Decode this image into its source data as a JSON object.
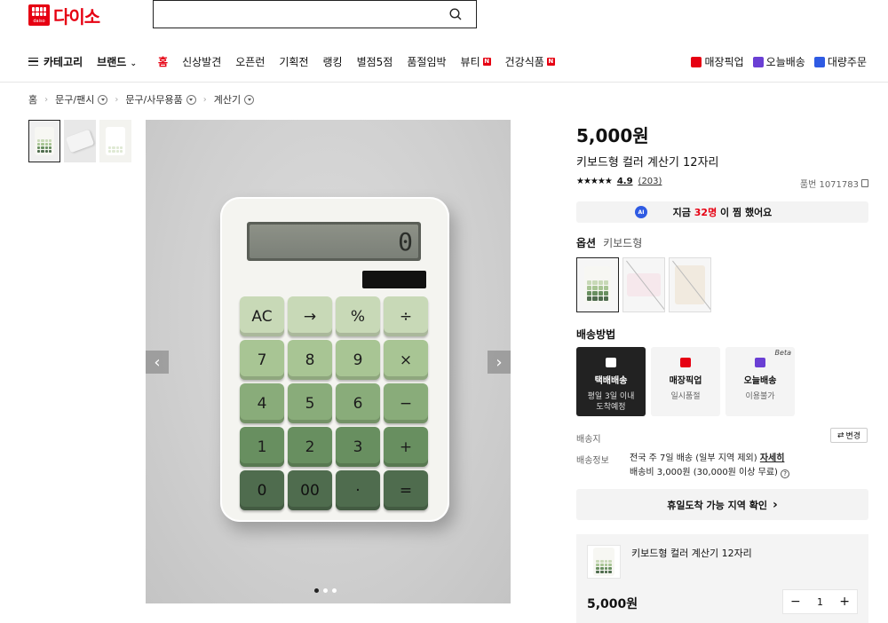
{
  "header": {
    "logo_text": "다이소",
    "logo_small": "daiso",
    "search_placeholder": ""
  },
  "nav": {
    "category": "카테고리",
    "brand": "브랜드",
    "items": [
      {
        "label": "홈",
        "badge": ""
      },
      {
        "label": "신상발견",
        "badge": ""
      },
      {
        "label": "오픈런",
        "badge": ""
      },
      {
        "label": "기획전",
        "badge": ""
      },
      {
        "label": "랭킹",
        "badge": ""
      },
      {
        "label": "별점5점",
        "badge": ""
      },
      {
        "label": "품절임박",
        "badge": ""
      },
      {
        "label": "뷰티",
        "badge": "N"
      },
      {
        "label": "건강식품",
        "badge": "N"
      }
    ],
    "right": [
      {
        "label": "매장픽업",
        "color": "#e60012"
      },
      {
        "label": "오늘배송",
        "color": "#6a3fd4"
      },
      {
        "label": "대량주문",
        "color": "#2f5be3"
      }
    ]
  },
  "breadcrumb": {
    "home": "홈",
    "items": [
      "문구/팬시",
      "문구/사무용품",
      "계산기"
    ]
  },
  "calculator": {
    "display": "0",
    "keys": [
      [
        "AC",
        "→",
        "%",
        "÷"
      ],
      [
        "7",
        "8",
        "9",
        "×"
      ],
      [
        "4",
        "5",
        "6",
        "−"
      ],
      [
        "1",
        "2",
        "3",
        "+"
      ],
      [
        "0",
        "00",
        "·",
        "="
      ]
    ]
  },
  "gallery": {
    "arrow_left": "‹",
    "arrow_right": "›",
    "slide_count": 3,
    "active_slide": 1
  },
  "product": {
    "price": "5,000원",
    "name": "키보드형 컬러 계산기 12자리",
    "stars": "★★★★★",
    "rating": "4.9",
    "review_count": "(203)",
    "product_no": "품번 1071783",
    "ai_badge": "AI",
    "wish_text_prefix": "지금",
    "wish_count": "32명",
    "wish_text_suffix": "이 찜 했어요"
  },
  "options": {
    "label": "옵션",
    "selected": "키보드형"
  },
  "shipping": {
    "title": "배송방법",
    "methods": [
      {
        "name": "택배배송",
        "desc1": "평일 3일 이내",
        "desc2": "도착예정",
        "icon_color": "#ffffff"
      },
      {
        "name": "매장픽업",
        "desc1": "일시품절",
        "desc2": "",
        "icon_color": "#e60012"
      },
      {
        "name": "오늘배송",
        "desc1": "이용불가",
        "desc2": "",
        "icon_color": "#6a3fd4",
        "beta": "Beta"
      }
    ],
    "address_label": "배송지",
    "change_btn": "변경",
    "change_icon": "⇄",
    "info_label": "배송정보",
    "info_line1": "전국 주 7일 배송 (일부 지역 제외)",
    "info_link": "자세히",
    "info_line2": "배송비 3,000원 (30,000원 이상 무료)",
    "help_icon": "?",
    "holiday_btn": "휴일도착 가능 지역 확인",
    "chevron": "›"
  },
  "summary": {
    "name": "키보드형 컬러 계산기 12자리",
    "price": "5,000원",
    "minus": "−",
    "qty": "1",
    "plus": "+"
  }
}
